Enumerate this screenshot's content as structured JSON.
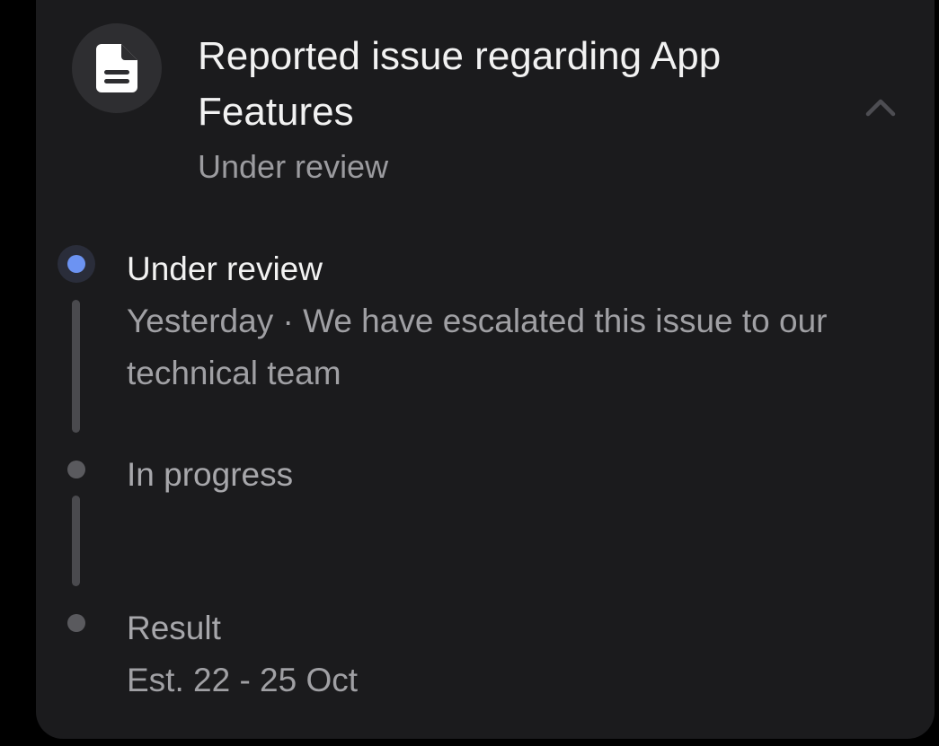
{
  "report": {
    "title": "Reported issue regarding App Features",
    "status": "Under review",
    "icon": "document-icon",
    "collapse_icon": "chevron-up-icon"
  },
  "timeline": {
    "steps": [
      {
        "label": "Under review",
        "description": "Yesterday · We have escalated this issue to our technical team",
        "state": "active"
      },
      {
        "label": "In progress",
        "description": "",
        "state": "pending"
      },
      {
        "label": "Result",
        "description": "Est. 22 - 25 Oct",
        "state": "pending"
      }
    ]
  },
  "colors": {
    "active_dot": "#6c93f2",
    "card_background": "#1b1b1d",
    "inactive_dot": "#5a5a5e"
  }
}
